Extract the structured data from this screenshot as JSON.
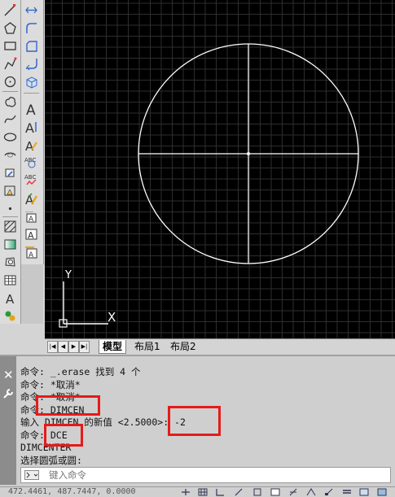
{
  "palette": {
    "draw_tools": [
      "line-icon",
      "polyline-icon",
      "pentagon-icon",
      "rectangle-icon",
      "arc-icon",
      "circle-icon",
      "revision-cloud-icon",
      "spline-icon",
      "ellipse-icon",
      "ellipse-arc-icon",
      "insert-block-icon",
      "make-block-icon",
      "point-icon",
      "hatch-icon",
      "gradient-icon",
      "region-icon",
      "table-icon",
      "multiline-text-icon",
      "add-selected-icon"
    ],
    "text_tools": [
      "arrow-join-icon",
      "round-corner-icon",
      "square-corner-icon",
      "cloud-shape-icon",
      "3d-box-icon",
      "text-A-icon",
      "text-AI-icon",
      "text-edit-icon",
      "spell-check-icon",
      "text-style-icon",
      "find-replace-icon",
      "text-scale-icon",
      "justify-text-icon",
      "text-box-icon"
    ]
  },
  "canvas": {
    "background": "#000000",
    "grid_color": "#2e2e2e",
    "entity_color": "#ffffff",
    "ucs_x_label": "X",
    "ucs_y_label": "Y"
  },
  "tabs": {
    "nav": [
      "|◀",
      "◀",
      "▶",
      "▶|"
    ],
    "items": [
      "模型",
      "布局1",
      "布局2"
    ],
    "active": "模型"
  },
  "command": {
    "history": [
      "命令: _.erase 找到 4 个",
      "命令: *取消*",
      "命令: *取消*",
      "命令: DIMCEN",
      "输入 DIMCEN 的新值 <2.5000>: -2",
      "命令: DCE",
      "DIMCENTER",
      "选择圆弧或圆:"
    ],
    "input_placeholder": "键入命令",
    "highlight_color": "#e61a1a"
  },
  "status": {
    "coordinates": "472.4461, 487.7447, 0.0000"
  }
}
